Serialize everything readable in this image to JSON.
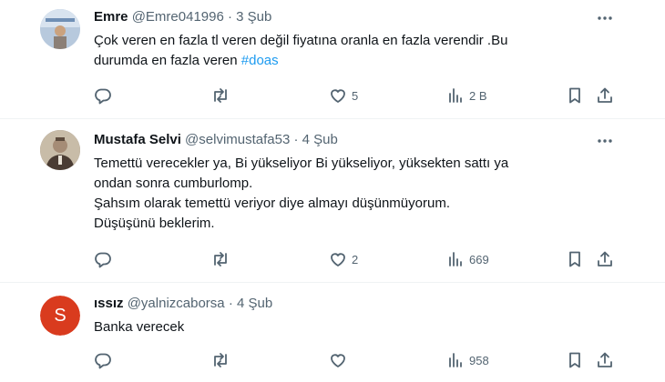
{
  "tweets": [
    {
      "name": "Emre",
      "handle": "@Emre041996",
      "sep": "·",
      "date": "3 Şub",
      "lines": [
        "Çok veren en fazla tl veren değil fiyatına oranla en fazla verendir .Bu",
        "durumda en fazla veren "
      ],
      "hashtag": "#doas",
      "likes": "5",
      "views": "2 B"
    },
    {
      "name": "Mustafa Selvi",
      "handle": "@selvimustafa53",
      "sep": "·",
      "date": "4 Şub",
      "lines": [
        "Temettü verecekler ya, Bi yükseliyor Bi yükseliyor, yüksekten sattı ya",
        "ondan sonra cumburlomp.",
        "Şahsım olarak temettü veriyor diye almayı düşünmüyorum.",
        "Düşüşünü beklerim."
      ],
      "likes": "2",
      "views": "669"
    },
    {
      "name": "ıssız",
      "handle": "@yalnizcaborsa",
      "sep": "·",
      "date": "4 Şub",
      "avatar_letter": "S",
      "avatar_color": "#d93b1e",
      "lines": [
        "Banka verecek"
      ],
      "views": "958"
    }
  ],
  "colors": {
    "hashtag": "#1d9bf0",
    "muted": "#536471",
    "text": "#0f1419"
  }
}
